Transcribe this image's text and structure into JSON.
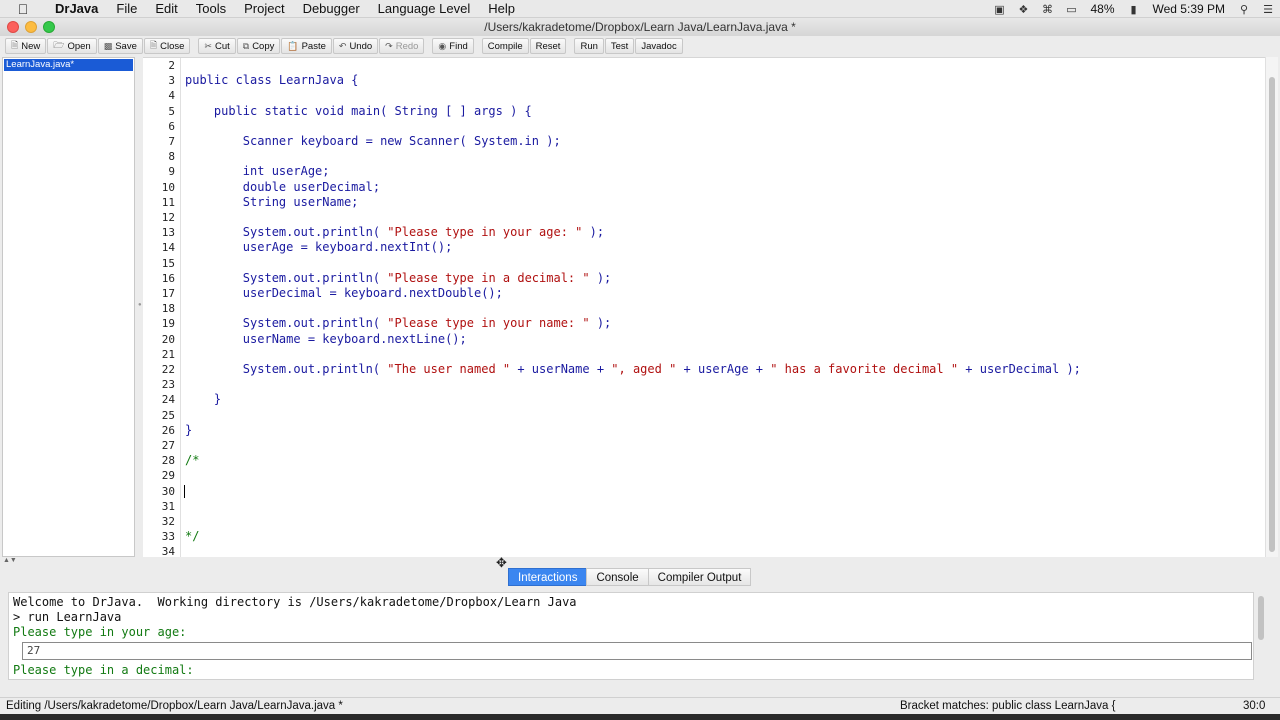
{
  "menubar": {
    "app": "DrJava",
    "items": [
      "File",
      "Edit",
      "Tools",
      "Project",
      "Debugger",
      "Language Level",
      "Help"
    ],
    "battery": "48%",
    "clock": "Wed 5:39 PM"
  },
  "window": {
    "title": "/Users/kakradetome/Dropbox/Learn Java/LearnJava.java *"
  },
  "toolbar": {
    "new": "New",
    "open": "Open",
    "save": "Save",
    "close": "Close",
    "cut": "Cut",
    "copy": "Copy",
    "paste": "Paste",
    "undo": "Undo",
    "redo": "Redo",
    "find": "Find",
    "compile": "Compile",
    "reset": "Reset",
    "run": "Run",
    "test": "Test",
    "javadoc": "Javadoc"
  },
  "files": [
    "LearnJava.java*"
  ],
  "editor": {
    "lines": [
      {
        "n": "2",
        "t": ""
      },
      {
        "n": "3",
        "t": "public class LearnJava {"
      },
      {
        "n": "4",
        "t": ""
      },
      {
        "n": "5",
        "t": "    public static void main( String [ ] args ) {"
      },
      {
        "n": "6",
        "t": ""
      },
      {
        "n": "7",
        "t": "        Scanner keyboard = new Scanner( System.in );"
      },
      {
        "n": "8",
        "t": ""
      },
      {
        "n": "9",
        "t": "        int userAge;"
      },
      {
        "n": "10",
        "t": "        double userDecimal;"
      },
      {
        "n": "11",
        "t": "        String userName;"
      },
      {
        "n": "12",
        "t": ""
      },
      {
        "n": "13",
        "t": "        System.out.println( \"Please type in your age: \" );"
      },
      {
        "n": "14",
        "t": "        userAge = keyboard.nextInt();"
      },
      {
        "n": "15",
        "t": ""
      },
      {
        "n": "16",
        "t": "        System.out.println( \"Please type in a decimal: \" );"
      },
      {
        "n": "17",
        "t": "        userDecimal = keyboard.nextDouble();"
      },
      {
        "n": "18",
        "t": ""
      },
      {
        "n": "19",
        "t": "        System.out.println( \"Please type in your name: \" );"
      },
      {
        "n": "20",
        "t": "        userName = keyboard.nextLine();"
      },
      {
        "n": "21",
        "t": ""
      },
      {
        "n": "22",
        "t": "        System.out.println( \"The user named \" + userName + \", aged \" + userAge + \" has a favorite decimal \" + userDecimal );"
      },
      {
        "n": "23",
        "t": ""
      },
      {
        "n": "24",
        "t": "    }"
      },
      {
        "n": "25",
        "t": ""
      },
      {
        "n": "26",
        "t": "}"
      },
      {
        "n": "27",
        "t": ""
      },
      {
        "n": "28",
        "t": "/*"
      },
      {
        "n": "29",
        "t": ""
      },
      {
        "n": "30",
        "t": ""
      },
      {
        "n": "31",
        "t": ""
      },
      {
        "n": "32",
        "t": ""
      },
      {
        "n": "33",
        "t": "*/"
      },
      {
        "n": "34",
        "t": ""
      }
    ]
  },
  "tabs": [
    "Interactions",
    "Console",
    "Compiler Output"
  ],
  "interactions": {
    "welcome": "Welcome to DrJava.  Working directory is /Users/kakradetome/Dropbox/Learn Java",
    "command": "> run LearnJava",
    "prompt1": "Please type in your age:",
    "input_value": "27",
    "prompt2": "Please type in a decimal:"
  },
  "status": {
    "editing": "Editing /Users/kakradetome/Dropbox/Learn Java/LearnJava.java *",
    "bracket": "Bracket matches: public class LearnJava {",
    "position": "30:0"
  }
}
